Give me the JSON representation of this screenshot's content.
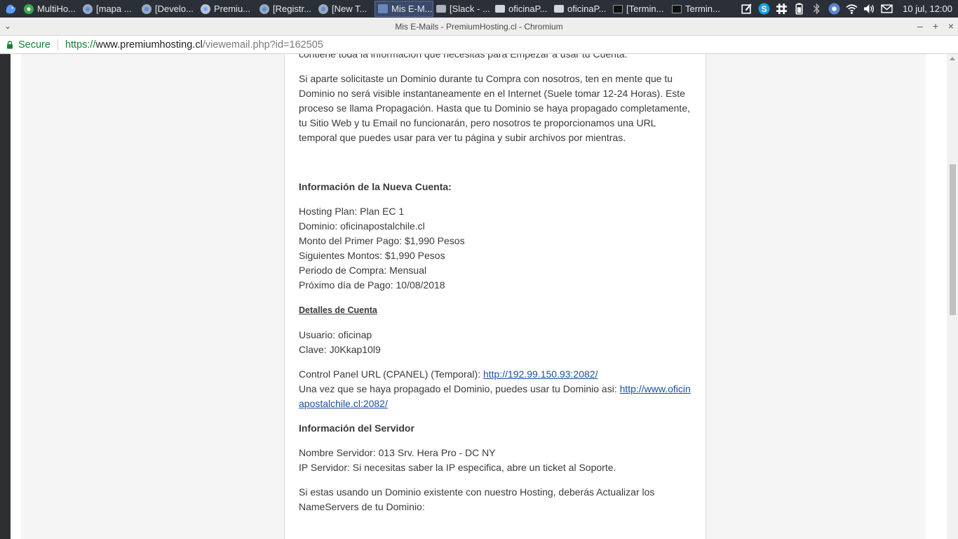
{
  "taskbar": {
    "tasks": [
      {
        "label": "MultiHo...",
        "icon": "green-chrome-icon"
      },
      {
        "label": "[mapa ...",
        "icon": "chromium-icon"
      },
      {
        "label": "[Develo...",
        "icon": "chromium-icon"
      },
      {
        "label": "Premiu...",
        "icon": "chrome-icon"
      },
      {
        "label": "[Registr...",
        "icon": "chromium-icon"
      },
      {
        "label": "[New T...",
        "icon": "chromium-icon"
      },
      {
        "label": "Mis E-M...",
        "icon": "page-icon"
      },
      {
        "label": "[Slack - ...",
        "icon": "slack-icon"
      },
      {
        "label": "oficinaP...",
        "icon": "folder-icon"
      },
      {
        "label": "oficinaP...",
        "icon": "folder-icon"
      },
      {
        "label": "[Termin...",
        "icon": "terminal-icon"
      },
      {
        "label": "Termin...",
        "icon": "terminal-icon"
      }
    ],
    "clock": "10 jul, 12:00"
  },
  "window": {
    "title": "Mis E-Mails - PremiumHosting.cl - Chromium"
  },
  "addressbar": {
    "secure_label": "Secure",
    "url_scheme": "https://",
    "url_host": "www.premiumhosting.cl",
    "url_path": "/viewemail.php?id=162505"
  },
  "email": {
    "cut_line": "contiene toda la información que necesitas para Empezar a usar tu Cuenta.",
    "propagation_paragraph": "Si aparte solicitaste un Dominio durante tu Compra con nosotros, ten en mente que tu Dominio no será visible instantaneamente en el Internet (Suele tomar 12-24 Horas). Este proceso se llama Propagación. Hasta que tu Dominio se haya propagado completamente, tu Sitio Web y tu Email no funcionarán, pero nosotros te proporcionamos una URL temporal que puedes usar para ver tu página y subir archivos por mientras.",
    "new_account_heading": "Información de la Nueva Cuenta:",
    "account_lines": [
      "Hosting Plan: Plan EC 1",
      "Dominio: oficinapostalchile.cl",
      "Monto del Primer Pago: $1,990 Pesos",
      "Siguientes Montos: $1,990 Pesos",
      "Periodo de Compra: Mensual",
      "Próximo día de Pago: 10/08/2018"
    ],
    "details_heading": "Detalles de Cuenta",
    "user_line": "Usuario: oficinap",
    "password_line": "Clave: J0Kkap10l9",
    "cpanel_label": "Control Panel URL (CPANEL) (Temporal): ",
    "cpanel_link": "http://192.99.150.93:2082/",
    "domain_cpanel_label": "Una vez que se haya propagado el Dominio, puedes usar tu Dominio asi: ",
    "domain_cpanel_link": "http://www.oficinapostalchile.cl:2082/",
    "server_heading": "Información del Servidor",
    "server_name": "Nombre Servidor: 013 Srv. Hera Pro - DC NY",
    "server_ip": "IP Servidor: Si necesitas saber la IP especifica, abre un ticket al Soporte.",
    "nameservers_paragraph": "Si estas usando un Dominio existente con nuestro Hosting, deberás Actualizar los NameServers de tu Dominio:"
  }
}
